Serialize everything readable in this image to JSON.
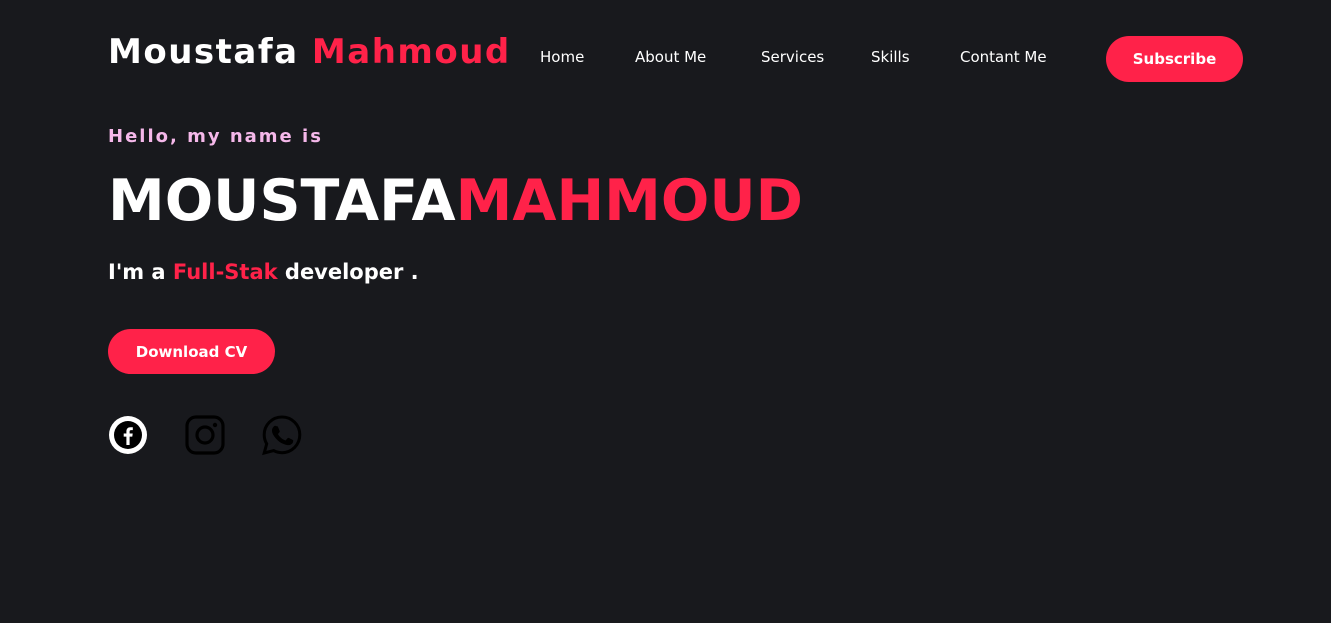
{
  "header": {
    "logo_first": "Moustafa",
    "logo_second": "Mahmoud",
    "nav": [
      {
        "label": "Home"
      },
      {
        "label": "About Me"
      },
      {
        "label": "Services"
      },
      {
        "label": "Skills"
      },
      {
        "label": "Contant Me"
      }
    ],
    "subscribe_label": "Subscribe"
  },
  "hero": {
    "greeting": "Hello, my name is",
    "name_first": "MOUSTAFA",
    "name_second": "MAHMOUD",
    "tagline_prefix": "I'm a",
    "tagline_highlight": "Full-Stak",
    "tagline_suffix": "developer .",
    "download_label": "Download CV"
  },
  "social": [
    {
      "icon": "facebook-icon"
    },
    {
      "icon": "instagram-icon"
    },
    {
      "icon": "whatsapp-icon"
    }
  ],
  "colors": {
    "background": "#18191d",
    "accent": "#ff2249",
    "greeting": "#f5b8ea",
    "text": "#ffffff"
  }
}
